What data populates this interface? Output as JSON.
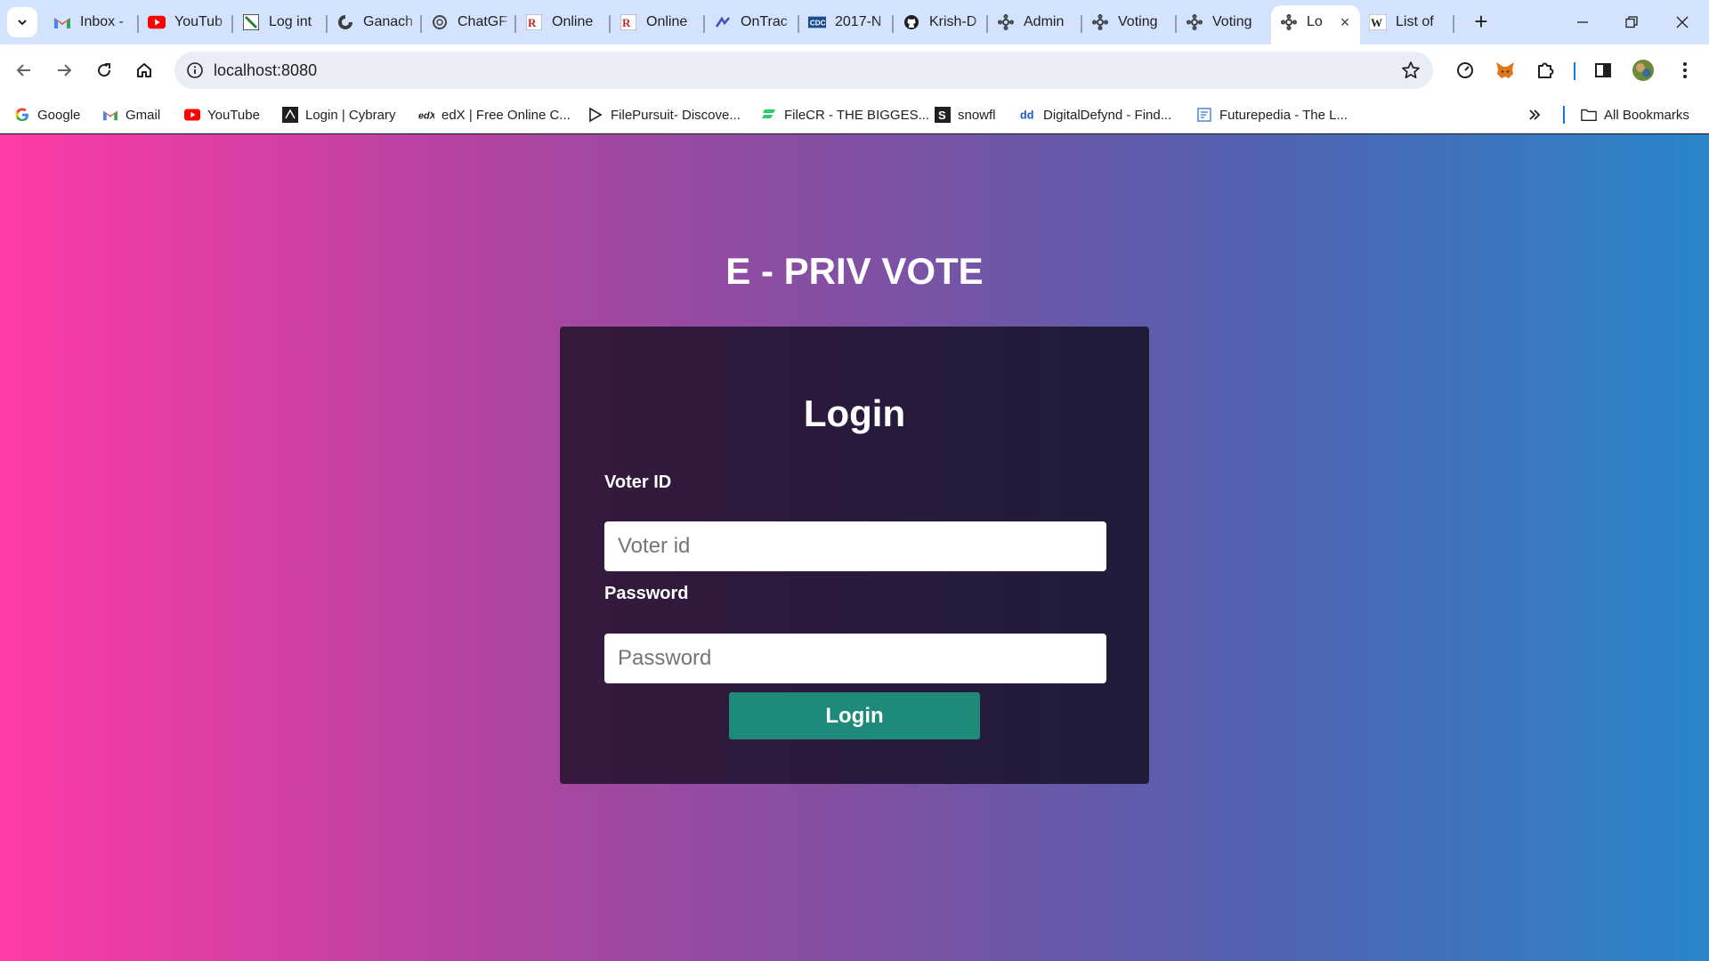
{
  "tabs": [
    {
      "title": "Inbox -",
      "icon": "gmail-icon"
    },
    {
      "title": "YouTub",
      "icon": "youtube-icon"
    },
    {
      "title": "Log int",
      "icon": "overleaf-icon"
    },
    {
      "title": "Ganach",
      "icon": "ganache-icon"
    },
    {
      "title": "ChatGF",
      "icon": "chatgpt-icon"
    },
    {
      "title": "Online",
      "icon": "rx-icon"
    },
    {
      "title": "Online",
      "icon": "rx-icon"
    },
    {
      "title": "OnTrac",
      "icon": "ontrack-icon"
    },
    {
      "title": "2017-N",
      "icon": "cdc-icon"
    },
    {
      "title": "Krish-D",
      "icon": "github-icon"
    },
    {
      "title": "Admin",
      "icon": "app-icon"
    },
    {
      "title": "Voting",
      "icon": "app-icon"
    },
    {
      "title": "Voting",
      "icon": "app-icon"
    },
    {
      "title": "Lo",
      "icon": "app-icon",
      "active": true
    },
    {
      "title": "List of",
      "icon": "wikipedia-icon"
    }
  ],
  "address_bar": {
    "url": "localhost:8080"
  },
  "bookmarks": [
    {
      "label": "Google",
      "icon": "google-icon"
    },
    {
      "label": "Gmail",
      "icon": "gmail-icon"
    },
    {
      "label": "YouTube",
      "icon": "youtube-icon"
    },
    {
      "label": "Login | Cybrary",
      "icon": "cybrary-icon"
    },
    {
      "label": "edX | Free Online C...",
      "icon": "edx-icon"
    },
    {
      "label": "FilePursuit- Discove...",
      "icon": "filepursuit-icon"
    },
    {
      "label": "FileCR - THE BIGGES...",
      "icon": "filecr-icon"
    },
    {
      "label": "snowfl",
      "icon": "snowfl-icon"
    },
    {
      "label": "DigitalDefynd - Find...",
      "icon": "digitaldefynd-icon"
    },
    {
      "label": "Futurepedia - The L...",
      "icon": "futurepedia-icon"
    }
  ],
  "all_bookmarks_label": "All Bookmarks",
  "page": {
    "brand": "E - PRIV VOTE",
    "login_title": "Login",
    "voter_id_label": "Voter ID",
    "voter_id_placeholder": "Voter id",
    "voter_id_value": "",
    "password_label": "Password",
    "password_placeholder": "Password",
    "password_value": "",
    "submit_label": "Login"
  },
  "colors": {
    "gradient_left": "#ff3aa8",
    "gradient_right": "#2a86c9",
    "card_bg": "#2a1a3d",
    "button_bg": "#1e8a7a",
    "tabstrip_bg": "#d3e3fd"
  }
}
